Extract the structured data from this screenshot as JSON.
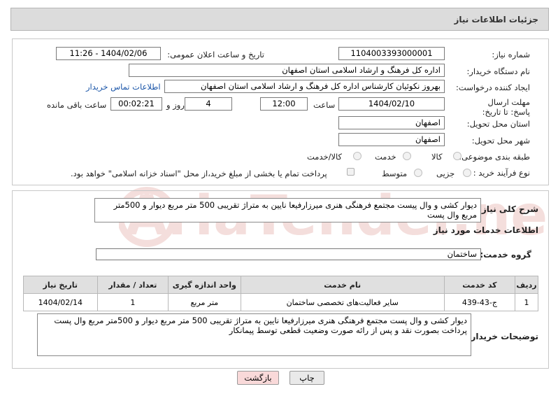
{
  "header": {
    "title": "جزئیات اطلاعات نیاز"
  },
  "fields": {
    "need_number_label": "شماره نیاز:",
    "need_number": "1104003393000001",
    "announce_label": "تاریخ و ساعت اعلان عمومی:",
    "announce_value": "1404/02/06 - 11:26",
    "buyer_label": "نام دستگاه خریدار:",
    "buyer_value": "اداره کل فرهنگ و ارشاد اسلامی استان اصفهان",
    "creator_label": "ایجاد کننده درخواست:",
    "creator_value": "بهروز نکوئیان کارشناس اداره کل فرهنگ و ارشاد اسلامی استان اصفهان",
    "contact_link": "اطلاعات تماس خریدار",
    "deadline_label": "مهلت ارسال پاسخ: تا تاریخ:",
    "deadline_date": "1404/02/10",
    "hour_label": "ساعت",
    "deadline_time": "12:00",
    "days_value": "4",
    "days_label": "روز و",
    "remaining_value": "00:02:21",
    "remaining_label": "ساعت باقی مانده",
    "province_label": "استان محل تحویل:",
    "province_value": "اصفهان",
    "city_label": "شهر محل تحویل:",
    "city_value": "اصفهان",
    "category_label": "طبقه بندی موضوعی:",
    "category_options": [
      "کالا",
      "خدمت",
      "کالا/خدمت"
    ],
    "process_label": "نوع فرآیند خرید :",
    "process_options": [
      "جزیی",
      "متوسط"
    ],
    "payment_note": "پرداخت تمام یا بخشی از مبلغ خرید،از محل \"اسناد خزانه اسلامی\" خواهد بود."
  },
  "summary": {
    "label": "شرح کلی نیاز:",
    "text": "دیوار کشی و وال پیست مجتمع فرهنگی هنری میرزارفیعا نایین به متراژ تقریبی 500 متر مربع دیوار و 500متر مربع وال پست"
  },
  "services": {
    "section_title": "اطلاعات خدمات مورد نیاز",
    "group_label": "گروه خدمت:",
    "group_value": "ساختمان",
    "columns": [
      "ردیف",
      "کد خدمت",
      "نام خدمت",
      "واحد اندازه گیری",
      "تعداد / مقدار",
      "تاریخ نیاز"
    ],
    "rows": [
      {
        "row": "1",
        "code": "ج-43-439",
        "name": "سایر فعالیت‌های تخصصی ساختمان",
        "unit": "متر مربع",
        "qty": "1",
        "date": "1404/02/14"
      }
    ]
  },
  "buyer_notes": {
    "label": "توضیحات خریدار:",
    "text": "دیوار کشی و وال پست مجتمع فرهنگی هنری میرزارفیعا نایین به متراژ تقریبی 500 متر مربع دیوار و 500متر مربع وال پست پرداخت بصورت نقد و پس از رائه صورت وضعیت قطعی توسط پیمانکار"
  },
  "buttons": {
    "print": "چاپ",
    "back": "بازگشت"
  },
  "watermark": "AriaTender.net",
  "colors": {
    "link": "#1a55a8",
    "back_button": "#f9d9d9",
    "print_button": "#e9e9e9",
    "watermark": "#c0392b"
  }
}
